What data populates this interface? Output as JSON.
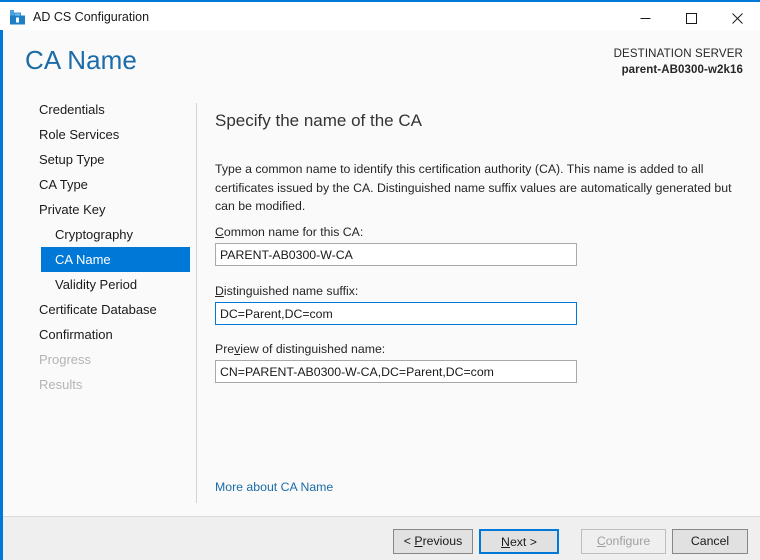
{
  "window": {
    "title": "AD CS Configuration",
    "icon": "adcs-toolbox-icon",
    "controls": {
      "minimize_label": "Minimize",
      "maximize_label": "Maximize",
      "close_label": "Close"
    }
  },
  "header": {
    "page_title": "CA Name",
    "destination_label": "DESTINATION SERVER",
    "destination_server": "parent-AB0300-w2k16"
  },
  "sidebar": {
    "items": [
      {
        "label": "Credentials",
        "sub": false,
        "state": "normal"
      },
      {
        "label": "Role Services",
        "sub": false,
        "state": "normal"
      },
      {
        "label": "Setup Type",
        "sub": false,
        "state": "normal"
      },
      {
        "label": "CA Type",
        "sub": false,
        "state": "normal"
      },
      {
        "label": "Private Key",
        "sub": false,
        "state": "normal"
      },
      {
        "label": "Cryptography",
        "sub": true,
        "state": "normal"
      },
      {
        "label": "CA Name",
        "sub": true,
        "state": "selected"
      },
      {
        "label": "Validity Period",
        "sub": true,
        "state": "normal"
      },
      {
        "label": "Certificate Database",
        "sub": false,
        "state": "normal"
      },
      {
        "label": "Confirmation",
        "sub": false,
        "state": "normal"
      },
      {
        "label": "Progress",
        "sub": false,
        "state": "disabled"
      },
      {
        "label": "Results",
        "sub": false,
        "state": "disabled"
      }
    ]
  },
  "main": {
    "heading": "Specify the name of the CA",
    "description": "Type a common name to identify this certification authority (CA). This name is added to all certificates issued by the CA. Distinguished name suffix values are automatically generated but can be modified.",
    "fields": {
      "common_name": {
        "label_prefix": "",
        "label_accel": "C",
        "label_rest": "ommon name for this CA:",
        "value": "PARENT-AB0300-W-CA",
        "placeholder": "",
        "focused": false
      },
      "dn_suffix": {
        "label_prefix": "",
        "label_accel": "D",
        "label_rest": "istinguished name suffix:",
        "value": "DC=Parent,DC=com",
        "placeholder": "",
        "focused": true
      },
      "preview_dn": {
        "label_prefix": "Pre",
        "label_accel": "v",
        "label_rest": "iew of distinguished name:",
        "value": "CN=PARENT-AB0300-W-CA,DC=Parent,DC=com",
        "placeholder": "",
        "focused": false
      }
    },
    "more_link": "More about CA Name"
  },
  "footer": {
    "buttons": [
      {
        "prefix": "< ",
        "accel": "P",
        "rest": "revious",
        "state": "normal"
      },
      {
        "prefix": "",
        "accel": "N",
        "rest": "ext >",
        "state": "default"
      },
      {
        "prefix": "",
        "accel": "C",
        "rest": "onfigure",
        "state": "disabled"
      },
      {
        "prefix": "",
        "accel": "",
        "rest": "Cancel",
        "state": "normal"
      }
    ]
  },
  "colors": {
    "accent": "#0078d7",
    "title_blue": "#1b6ca8",
    "link": "#1b6ca8",
    "footer_bg": "#efefef",
    "disabled_text": "#b4b4b4"
  }
}
